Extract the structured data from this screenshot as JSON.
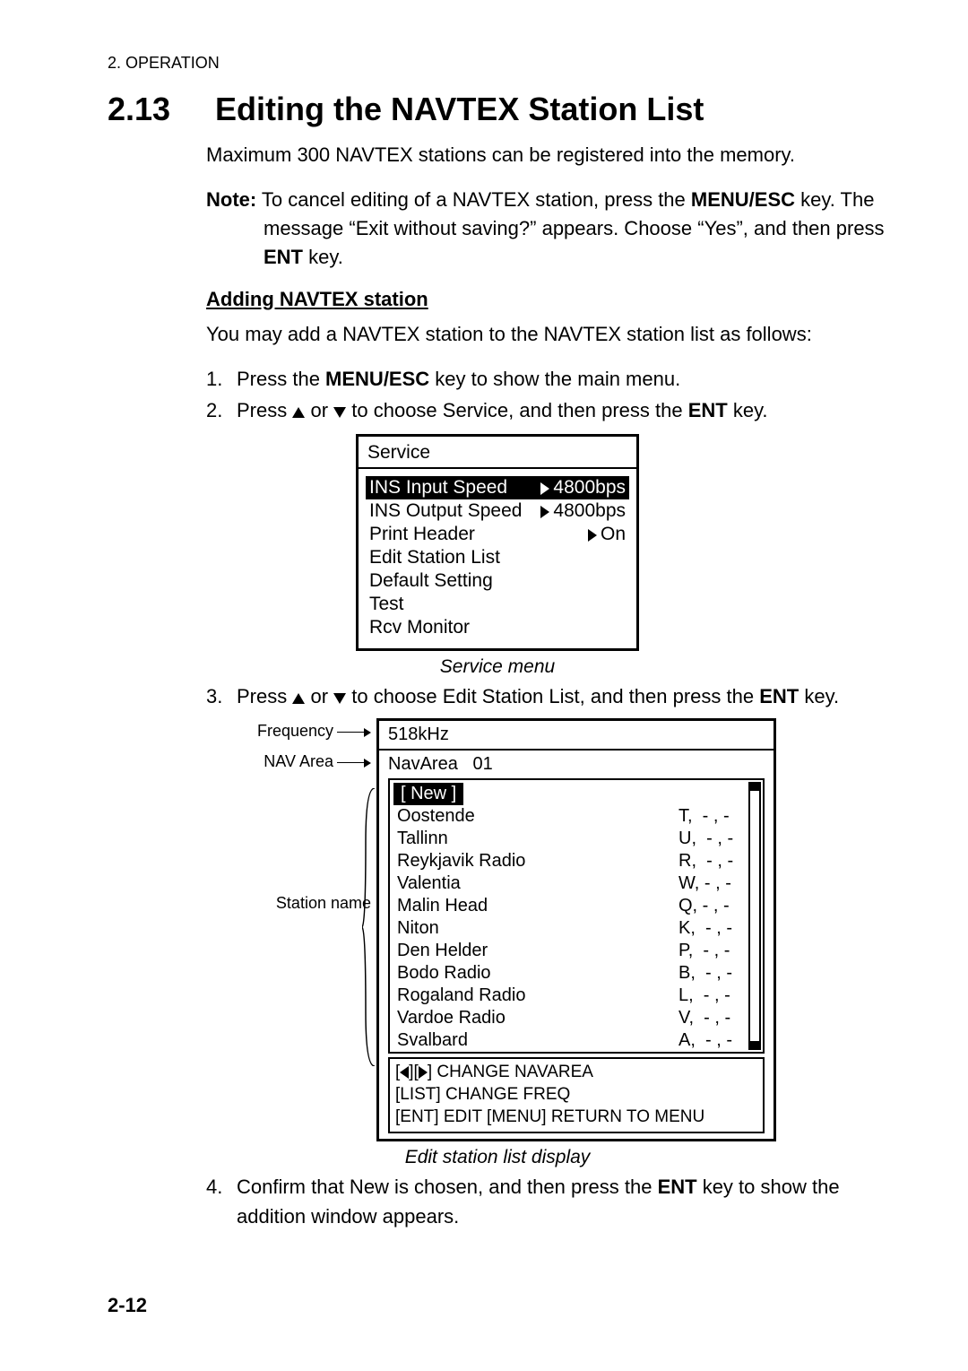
{
  "running_head": "2.  OPERATION",
  "section_number": "2.13",
  "section_title": "Editing the NAVTEX Station List",
  "intro": "Maximum 300 NAVTEX stations can be registered into the memory.",
  "note": {
    "label": "Note:",
    "line1_rest": " To cancel editing of a NAVTEX station, press the ",
    "menu_esc": "MENU/ESC",
    "line1_tail": " key. The",
    "line2": "message “Exit without saving?” appears. Choose “Yes”, and then press",
    "ent_label": "ENT",
    "line3_tail": " key."
  },
  "subhead": "Adding NAVTEX station",
  "adding_intro": "You may add a NAVTEX station to the NAVTEX station list as follows:",
  "steps": {
    "s1_pre": "Press the ",
    "s1_bold": "MENU/ESC",
    "s1_post": " key to show the main menu.",
    "s2_pre": "Press ",
    "s2_mid": " or ",
    "s2_post": " to choose Service, and then press the ",
    "s2_bold": "ENT",
    "s2_tail": " key.",
    "s3_pre": "Press ",
    "s3_mid": " or ",
    "s3_post": " to choose Edit Station List, and then press the ",
    "s3_bold": "ENT",
    "s3_tail": " key.",
    "s4_pre": "Confirm that New is chosen, and then press the ",
    "s4_bold": "ENT",
    "s4_post": " key to show the addition window appears."
  },
  "service_menu": {
    "title": "Service",
    "rows": [
      {
        "l": "INS Input Speed",
        "r": "4800bps",
        "hl": true
      },
      {
        "l": "INS Output Speed",
        "r": "4800bps",
        "hl": false
      },
      {
        "l": "Print Header",
        "r": "On",
        "hl": false
      },
      {
        "l": "Edit Station List",
        "r": "",
        "hl": false
      },
      {
        "l": "Default Setting",
        "r": "",
        "hl": false
      },
      {
        "l": "Test",
        "r": "",
        "hl": false
      },
      {
        "l": "Rcv Monitor",
        "r": "",
        "hl": false
      }
    ],
    "caption": "Service menu"
  },
  "station_labels": {
    "frequency": "Frequency",
    "navarea": "NAV Area",
    "station_name": "Station name"
  },
  "station_list": {
    "freq": "518kHz",
    "navarea_label": "NavArea",
    "navarea_value": "01",
    "new_label": "[ New ]",
    "rows": [
      {
        "n": "Oostende",
        "c": "T,  - , -"
      },
      {
        "n": "Tallinn",
        "c": "U,  - , -"
      },
      {
        "n": "Reykjavik Radio",
        "c": "R,  - , -"
      },
      {
        "n": "Valentia",
        "c": "W, - , -"
      },
      {
        "n": "Malin Head",
        "c": "Q, - , -"
      },
      {
        "n": "Niton",
        "c": "K,  - , -"
      },
      {
        "n": "Den Helder",
        "c": "P,  - , -"
      },
      {
        "n": "Bodo Radio",
        "c": "B,  - , -"
      },
      {
        "n": "Rogaland Radio",
        "c": "L,  - , -"
      },
      {
        "n": "Vardoe Radio",
        "c": "V,  - , -"
      },
      {
        "n": "Svalbard",
        "c": "A,  - , -"
      }
    ],
    "help1_a": "[",
    "help1_mid": "][",
    "help1_b": "] CHANGE NAVAREA",
    "help2": "[LIST] CHANGE FREQ",
    "help3": "[ENT] EDIT    [MENU] RETURN TO MENU",
    "caption": "Edit station list display"
  },
  "page_number": "2-12"
}
